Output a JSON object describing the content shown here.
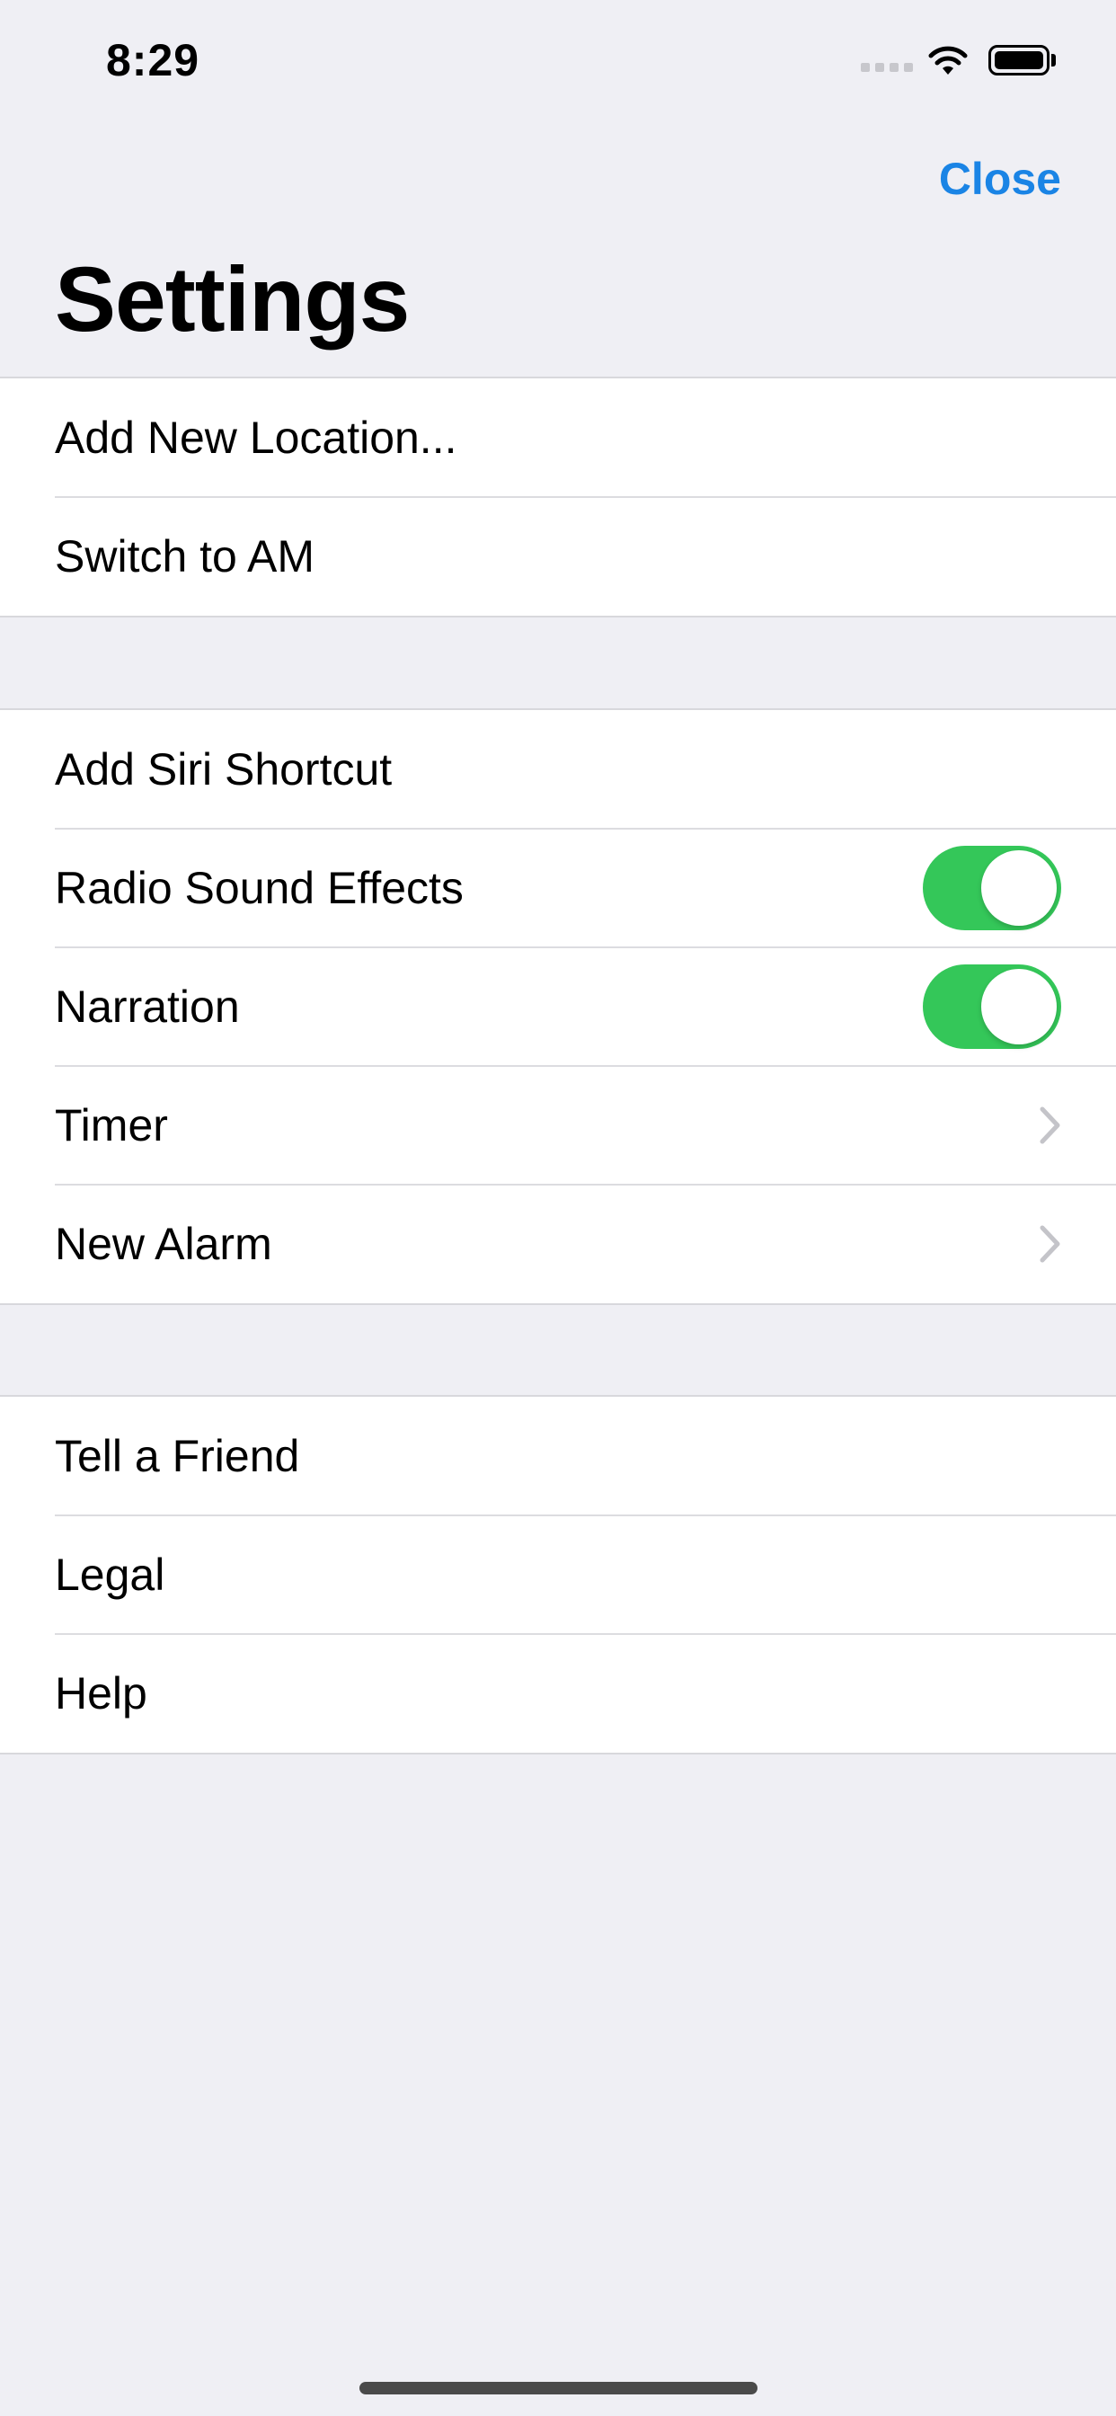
{
  "status_bar": {
    "time": "8:29"
  },
  "nav": {
    "close_label": "Close",
    "title": "Settings"
  },
  "sections": [
    {
      "rows": [
        {
          "label": "Add New Location..."
        },
        {
          "label": "Switch to AM"
        }
      ]
    },
    {
      "rows": [
        {
          "label": "Add Siri Shortcut"
        },
        {
          "label": "Radio Sound Effects",
          "toggle": true
        },
        {
          "label": "Narration",
          "toggle": true
        },
        {
          "label": "Timer",
          "accessory": "chevron-right-icon"
        },
        {
          "label": "New Alarm",
          "accessory": "chevron-right-icon"
        }
      ]
    },
    {
      "rows": [
        {
          "label": "Tell a Friend"
        },
        {
          "label": "Legal"
        },
        {
          "label": "Help"
        }
      ]
    }
  ],
  "colors": {
    "accent": "#1a84e5",
    "toggle_on": "#34c759",
    "background": "#efeff4"
  }
}
